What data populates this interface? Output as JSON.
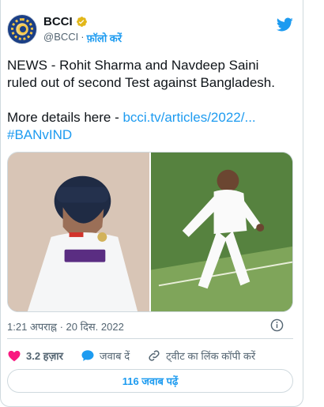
{
  "account": {
    "display_name": "BCCI",
    "handle": "@BCCI",
    "separator": "·",
    "follow_label": "फ़ॉलो करें"
  },
  "tweet": {
    "line1": "NEWS - Rohit Sharma and Navdeep Saini ruled out of second Test against Bangladesh.",
    "line2_prefix": "More details here - ",
    "line2_link": "bcci.tv/articles/2022/...",
    "hashtag": "#BANvIND"
  },
  "timestamp": "1:21 अपराह्न · 20 दिस. 2022",
  "actions": {
    "like_count": "3.2 हज़ार",
    "reply_label": "जवाब दें",
    "copy_link_label": "ट्वीट का लिंक कॉपी करें"
  },
  "replies_button_label": "116 जवाब पढ़ें",
  "colors": {
    "accent": "#1d9bf0",
    "like": "#f91880",
    "text": "#0f1419",
    "muted": "#536471"
  },
  "icons": [
    "verified-badge-icon",
    "twitter-bird-icon",
    "info-icon",
    "heart-icon",
    "reply-bubble-icon",
    "link-icon"
  ]
}
